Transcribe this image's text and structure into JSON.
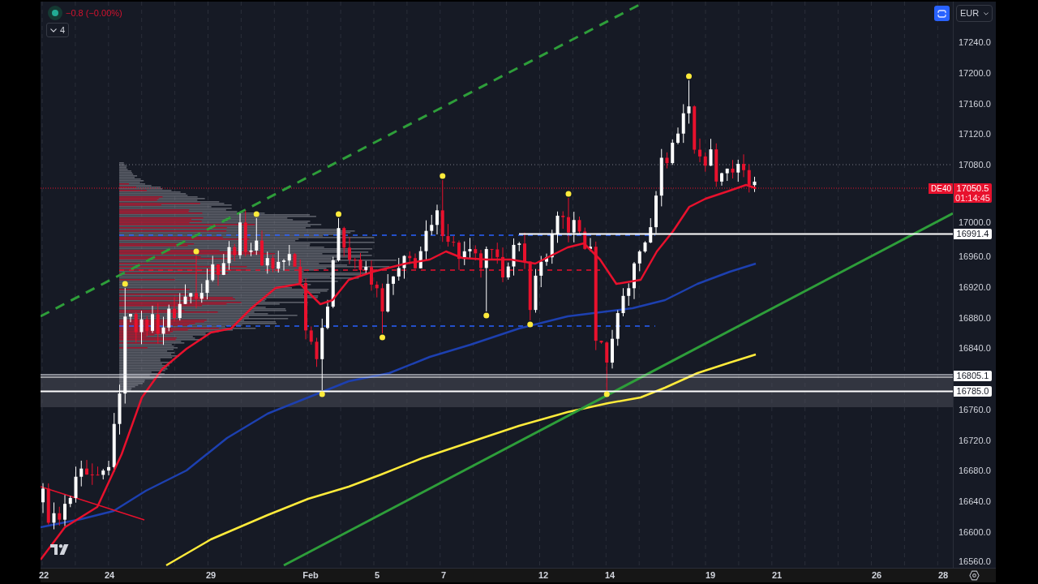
{
  "legend": {
    "change": "−0.8 (−0.00%)",
    "indicators_button": {
      "count": "4"
    }
  },
  "toolbar": {
    "currency": "EUR"
  },
  "price_axis": {
    "ticks": [
      "17240.0",
      "17200.0",
      "17160.0",
      "17120.0",
      "17080.0",
      "17000.0",
      "16960.0",
      "16920.0",
      "16880.0",
      "16840.0",
      "16760.0",
      "16720.0",
      "16680.0",
      "16640.0",
      "16600.0",
      "16560.0"
    ]
  },
  "symbol_tag": "DE40",
  "last_price": {
    "price": "17050.5",
    "countdown": "01:14:45"
  },
  "level_tags": [
    "16991.4",
    "16805.1",
    "16785.0"
  ],
  "time_axis": {
    "labels": [
      "22",
      "24",
      "29",
      "Feb",
      "5",
      "7",
      "12",
      "14",
      "19",
      "21",
      "26",
      "28"
    ]
  }
}
